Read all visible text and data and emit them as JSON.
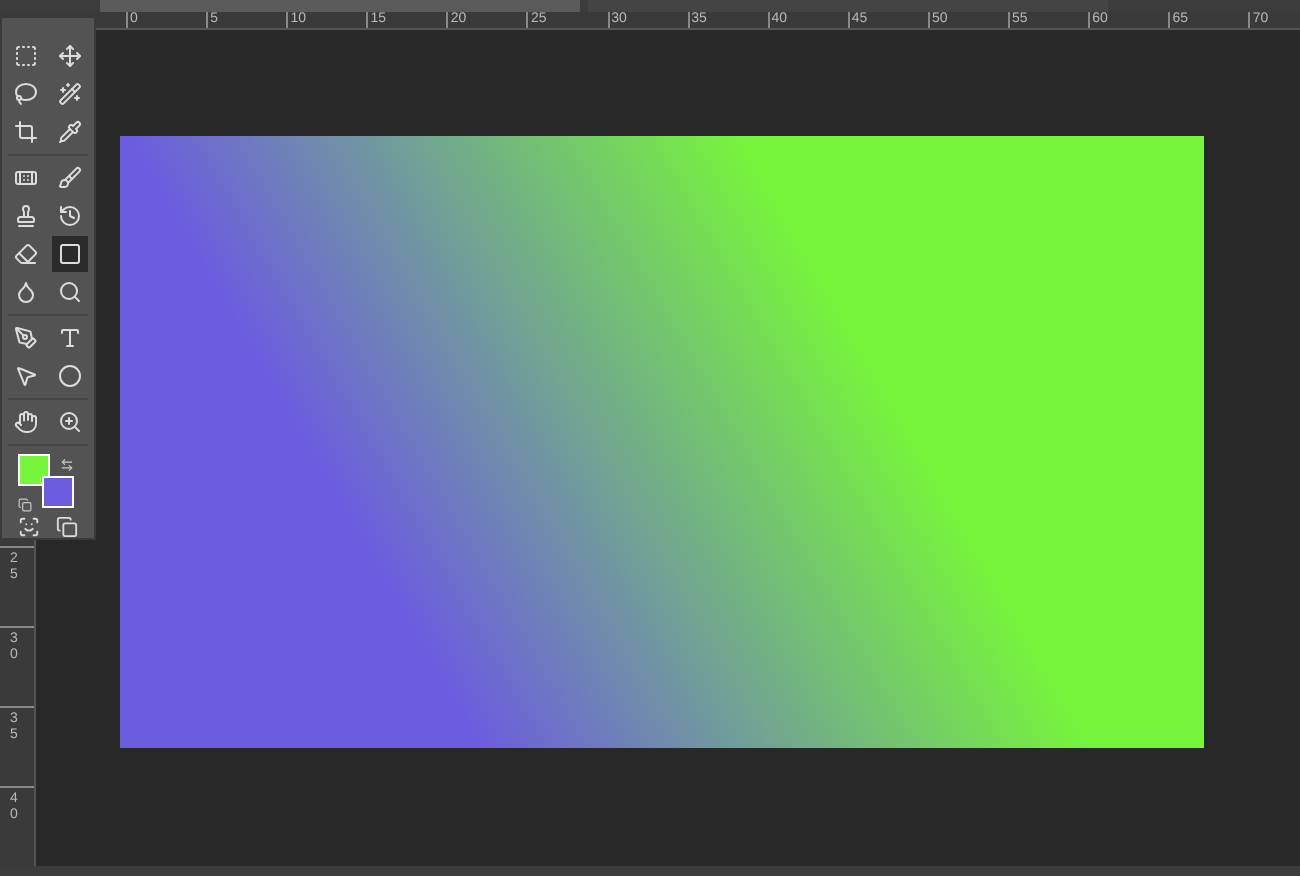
{
  "top_ruler": {
    "labels": [
      "0",
      "5",
      "10",
      "15",
      "20",
      "25",
      "30",
      "35",
      "40",
      "45",
      "50",
      "55",
      "60",
      "65",
      "70"
    ]
  },
  "left_ruler": {
    "labels": [
      "25",
      "30",
      "35",
      "40"
    ]
  },
  "toolbar": {
    "tools": [
      {
        "selected": false
      },
      {
        "selected": false
      },
      {
        "selected": false
      },
      {
        "selected": false
      },
      {
        "selected": false
      },
      {
        "selected": false
      },
      {
        "selected": false
      },
      {
        "selected": false
      },
      {
        "selected": false
      },
      {
        "selected": false
      },
      {
        "selected": false
      },
      {
        "selected": true
      },
      {
        "selected": false
      },
      {
        "selected": false
      },
      {
        "selected": false
      },
      {
        "selected": false
      },
      {
        "selected": false
      },
      {
        "selected": false
      },
      {
        "selected": false
      },
      {
        "selected": false
      }
    ],
    "foreground": {
      "color": "#77f53b"
    },
    "background": {
      "color": "#6c5ce0"
    }
  }
}
